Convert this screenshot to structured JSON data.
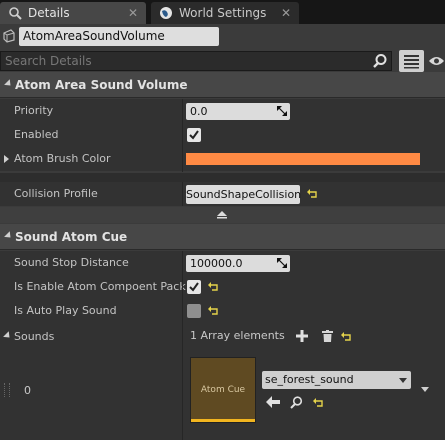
{
  "tabs": [
    {
      "label": "Details",
      "icon": "magnifier-details-icon",
      "active": true
    },
    {
      "label": "World Settings",
      "icon": "globe-icon",
      "active": false
    }
  ],
  "toolbar": {
    "actor_name": "AtomAreaSoundVolume",
    "search_placeholder": "Search Details"
  },
  "sections": {
    "atom_area": {
      "title": "Atom Area Sound Volume",
      "priority_label": "Priority",
      "priority_value": "0.0",
      "enabled_label": "Enabled",
      "enabled_checked": true,
      "brush_color_label": "Atom Brush Color",
      "brush_color": "#ff8a44"
    },
    "collision": {
      "label": "Collision Profile",
      "value": "SoundShapeCollision"
    },
    "sound_atom_cue": {
      "title": "Sound Atom Cue",
      "stop_distance_label": "Sound Stop Distance",
      "stop_distance_value": "100000.0",
      "enable_pack_label": "Is Enable Atom Compoent Pack",
      "enable_pack_checked": true,
      "auto_play_label": "Is Auto Play Sound",
      "auto_play_checked": false,
      "sounds_label": "Sounds",
      "array_text": "1 Array elements",
      "element_index": "0",
      "thumb_text": "Atom Cue",
      "asset_value": "se_forest_sound"
    }
  },
  "colors": {
    "accent_asset": "#f2b51f",
    "reset_arrow": "#e5d34a"
  }
}
